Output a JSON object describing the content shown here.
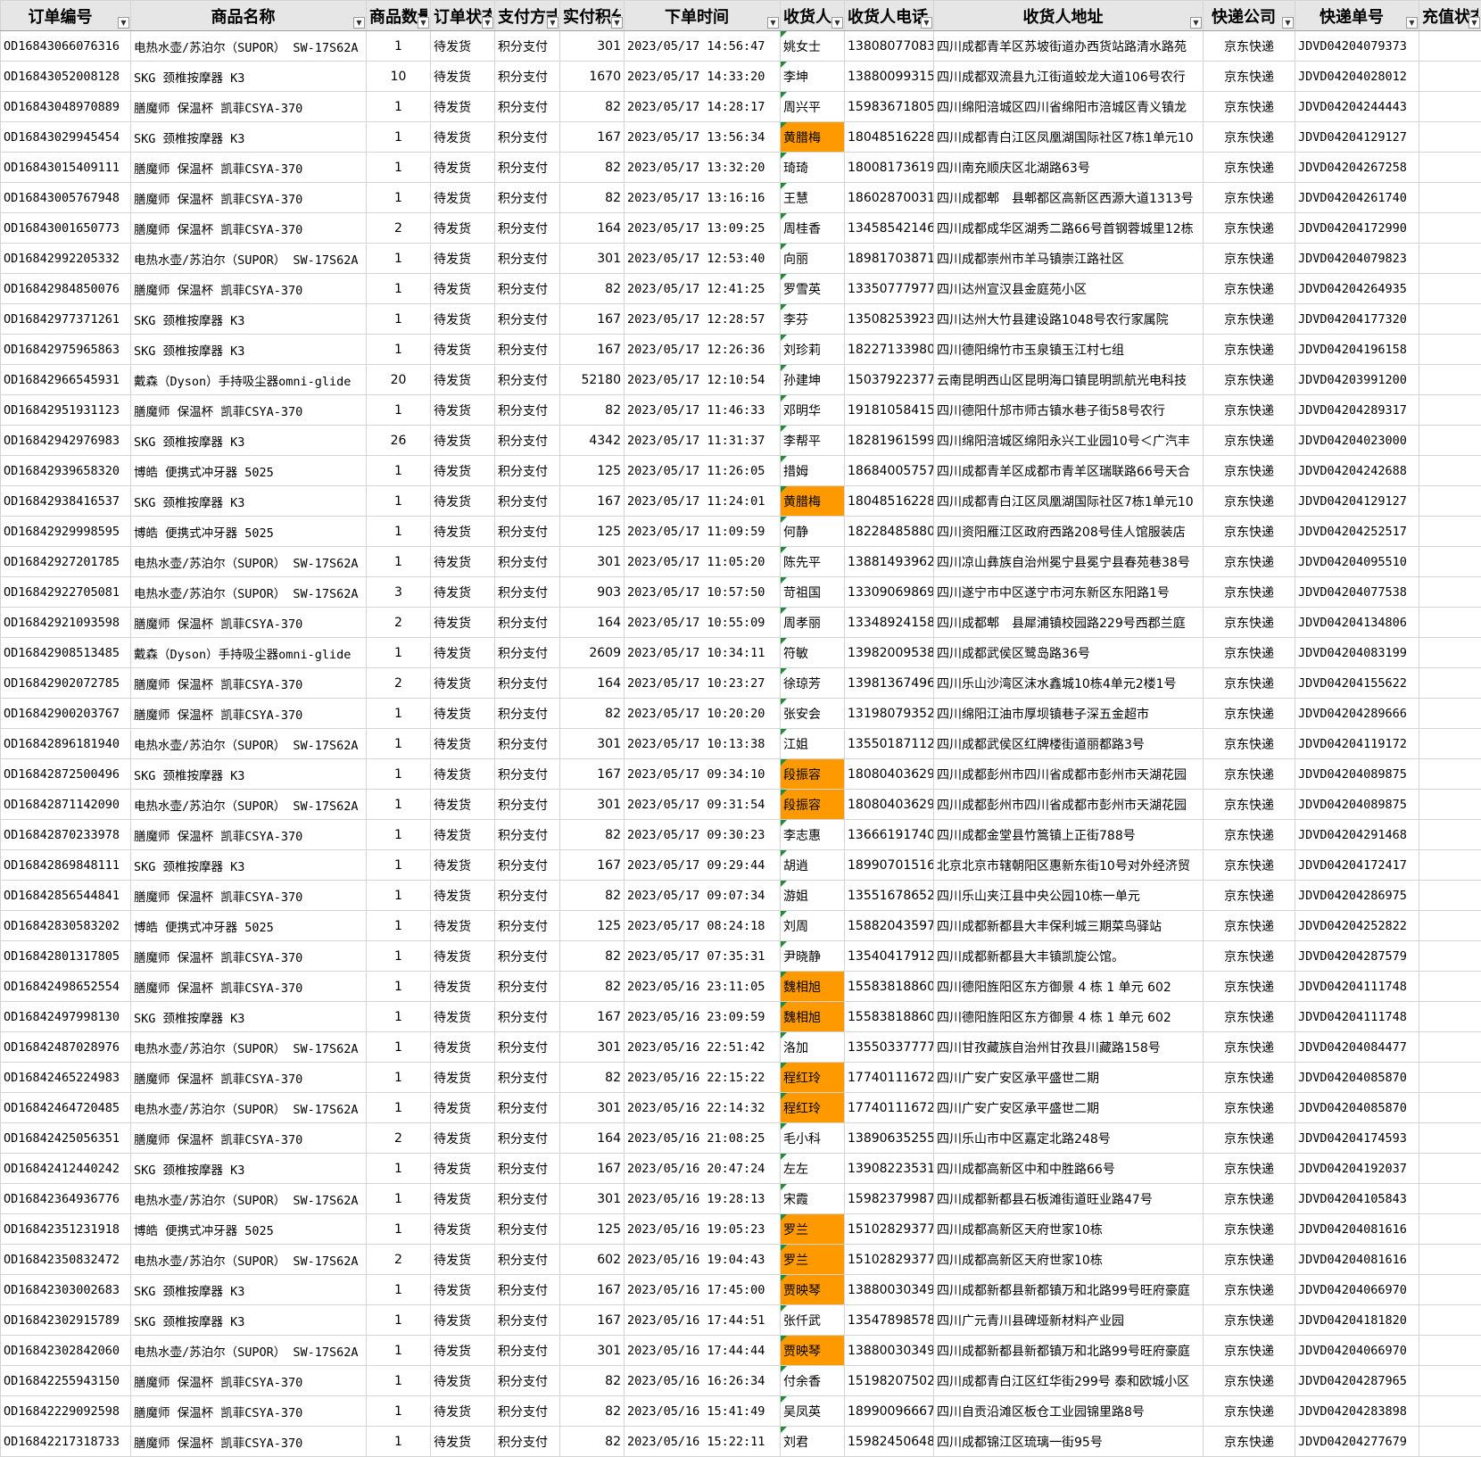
{
  "columns": [
    "订单编号",
    "商品名称",
    "商品数量",
    "订单状态",
    "支付方式",
    "实付积分",
    "下单时间",
    "收货人",
    "收货人电话",
    "收货人地址",
    "快递公司",
    "快递单号",
    "充值状态"
  ],
  "theme": {
    "highlight": "#ff9900",
    "header_bg": "#e7e6e6",
    "note_marker": "#1e8c3a"
  },
  "icons": {
    "filter": "dropdown-arrow-icon"
  },
  "rows": [
    {
      "id": "OD16843066076316",
      "product": "电热水壶/苏泊尔（SUPOR） SW-17S62A",
      "qty": "1",
      "status": "待发货",
      "pay": "积分支付",
      "points": "301",
      "time": "2023/05/17 14:56:47",
      "name": "姚女士",
      "hl": false,
      "phone": "13808077083",
      "addr": "四川成都青羊区苏坡街道办西货站路清水路苑",
      "courier": "京东快递",
      "track": "JDVD04204079373",
      "recharge": ""
    },
    {
      "id": "OD16843052008128",
      "product": "SKG 颈椎按摩器 K3",
      "qty": "10",
      "status": "待发货",
      "pay": "积分支付",
      "points": "1670",
      "time": "2023/05/17 14:33:20",
      "name": "李坤",
      "hl": false,
      "phone": "13880099315",
      "addr": "四川成都双流县九江街道蛟龙大道106号农行",
      "courier": "京东快递",
      "track": "JDVD04204028012",
      "recharge": ""
    },
    {
      "id": "OD16843048970889",
      "product": "膳魔师 保温杯 凯菲CSYA-370",
      "qty": "1",
      "status": "待发货",
      "pay": "积分支付",
      "points": "82",
      "time": "2023/05/17 14:28:17",
      "name": "周兴平",
      "hl": false,
      "phone": "15983671805",
      "addr": "四川绵阳涪城区四川省绵阳市涪城区青义镇龙",
      "courier": "京东快递",
      "track": "JDVD04204244443",
      "recharge": ""
    },
    {
      "id": "OD16843029945454",
      "product": "SKG 颈椎按摩器 K3",
      "qty": "1",
      "status": "待发货",
      "pay": "积分支付",
      "points": "167",
      "time": "2023/05/17 13:56:34",
      "name": "黄腊梅",
      "hl": true,
      "phone": "18048516228",
      "addr": "四川成都青白江区凤凰湖国际社区7栋1单元10",
      "courier": "京东快递",
      "track": "JDVD04204129127",
      "recharge": ""
    },
    {
      "id": "OD16843015409111",
      "product": "膳魔师 保温杯 凯菲CSYA-370",
      "qty": "1",
      "status": "待发货",
      "pay": "积分支付",
      "points": "82",
      "time": "2023/05/17 13:32:20",
      "name": "琦琦",
      "hl": false,
      "phone": "18008173619",
      "addr": "四川南充顺庆区北湖路63号",
      "courier": "京东快递",
      "track": "JDVD04204267258",
      "recharge": ""
    },
    {
      "id": "OD16843005767948",
      "product": "膳魔师 保温杯 凯菲CSYA-370",
      "qty": "1",
      "status": "待发货",
      "pay": "积分支付",
      "points": "82",
      "time": "2023/05/17 13:16:16",
      "name": "王慧",
      "hl": false,
      "phone": "18602870031",
      "addr": "四川成都郫　县郫都区高新区西源大道1313号",
      "courier": "京东快递",
      "track": "JDVD04204261740",
      "recharge": ""
    },
    {
      "id": "OD16843001650773",
      "product": "膳魔师 保温杯 凯菲CSYA-370",
      "qty": "2",
      "status": "待发货",
      "pay": "积分支付",
      "points": "164",
      "time": "2023/05/17 13:09:25",
      "name": "周桂香",
      "hl": false,
      "phone": "13458542146",
      "addr": "四川成都成华区湖秀二路66号首钢蓉城里12栋",
      "courier": "京东快递",
      "track": "JDVD04204172990",
      "recharge": ""
    },
    {
      "id": "OD16842992205332",
      "product": "电热水壶/苏泊尔（SUPOR） SW-17S62A",
      "qty": "1",
      "status": "待发货",
      "pay": "积分支付",
      "points": "301",
      "time": "2023/05/17 12:53:40",
      "name": "向丽",
      "hl": false,
      "phone": "18981703871",
      "addr": "四川成都崇州市羊马镇崇江路社区",
      "courier": "京东快递",
      "track": "JDVD04204079823",
      "recharge": ""
    },
    {
      "id": "OD16842984850076",
      "product": "膳魔师 保温杯 凯菲CSYA-370",
      "qty": "1",
      "status": "待发货",
      "pay": "积分支付",
      "points": "82",
      "time": "2023/05/17 12:41:25",
      "name": "罗雪英",
      "hl": false,
      "phone": "13350777977",
      "addr": "四川达州宣汉县金庭苑小区",
      "courier": "京东快递",
      "track": "JDVD04204264935",
      "recharge": ""
    },
    {
      "id": "OD16842977371261",
      "product": "SKG 颈椎按摩器 K3",
      "qty": "1",
      "status": "待发货",
      "pay": "积分支付",
      "points": "167",
      "time": "2023/05/17 12:28:57",
      "name": "李芬",
      "hl": false,
      "phone": "13508253923",
      "addr": "四川达州大竹县建设路1048号农行家属院",
      "courier": "京东快递",
      "track": "JDVD04204177320",
      "recharge": ""
    },
    {
      "id": "OD16842975965863",
      "product": "SKG 颈椎按摩器 K3",
      "qty": "1",
      "status": "待发货",
      "pay": "积分支付",
      "points": "167",
      "time": "2023/05/17 12:26:36",
      "name": "刘珍莉",
      "hl": false,
      "phone": "18227133980",
      "addr": "四川德阳绵竹市玉泉镇玉江村七组",
      "courier": "京东快递",
      "track": "JDVD04204196158",
      "recharge": ""
    },
    {
      "id": "OD16842966545931",
      "product": "戴森（Dyson）手持吸尘器omni-glide",
      "qty": "20",
      "status": "待发货",
      "pay": "积分支付",
      "points": "52180",
      "time": "2023/05/17 12:10:54",
      "name": "孙建坤",
      "hl": false,
      "phone": "15037922377",
      "addr": "云南昆明西山区昆明海口镇昆明凯航光电科技",
      "courier": "京东快递",
      "track": "JDVD04203991200",
      "recharge": ""
    },
    {
      "id": "OD16842951931123",
      "product": "膳魔师 保温杯 凯菲CSYA-370",
      "qty": "1",
      "status": "待发货",
      "pay": "积分支付",
      "points": "82",
      "time": "2023/05/17 11:46:33",
      "name": "邓明华",
      "hl": false,
      "phone": "19181058415",
      "addr": "四川德阳什邡市师古镇水巷子街58号农行",
      "courier": "京东快递",
      "track": "JDVD04204289317",
      "recharge": ""
    },
    {
      "id": "OD16842942976983",
      "product": "SKG 颈椎按摩器 K3",
      "qty": "26",
      "status": "待发货",
      "pay": "积分支付",
      "points": "4342",
      "time": "2023/05/17 11:31:37",
      "name": "李帮平",
      "hl": false,
      "phone": "18281961599",
      "addr": "四川绵阳涪城区绵阳永兴工业园10号＜广汽丰",
      "courier": "京东快递",
      "track": "JDVD04204023000",
      "recharge": ""
    },
    {
      "id": "OD16842939658320",
      "product": "博皓 便携式冲牙器 5025",
      "qty": "1",
      "status": "待发货",
      "pay": "积分支付",
      "points": "125",
      "time": "2023/05/17 11:26:05",
      "name": "措姆",
      "hl": false,
      "phone": "18684005757",
      "addr": "四川成都青羊区成都市青羊区瑞联路66号天合",
      "courier": "京东快递",
      "track": "JDVD04204242688",
      "recharge": ""
    },
    {
      "id": "OD16842938416537",
      "product": "SKG 颈椎按摩器 K3",
      "qty": "1",
      "status": "待发货",
      "pay": "积分支付",
      "points": "167",
      "time": "2023/05/17 11:24:01",
      "name": "黄腊梅",
      "hl": true,
      "phone": "18048516228",
      "addr": "四川成都青白江区凤凰湖国际社区7栋1单元10",
      "courier": "京东快递",
      "track": "JDVD04204129127",
      "recharge": ""
    },
    {
      "id": "OD16842929998595",
      "product": "博皓 便携式冲牙器 5025",
      "qty": "1",
      "status": "待发货",
      "pay": "积分支付",
      "points": "125",
      "time": "2023/05/17 11:09:59",
      "name": "何静",
      "hl": false,
      "phone": "18228485880",
      "addr": "四川资阳雁江区政府西路208号佳人馆服装店",
      "courier": "京东快递",
      "track": "JDVD04204252517",
      "recharge": ""
    },
    {
      "id": "OD16842927201785",
      "product": "电热水壶/苏泊尔（SUPOR） SW-17S62A",
      "qty": "1",
      "status": "待发货",
      "pay": "积分支付",
      "points": "301",
      "time": "2023/05/17 11:05:20",
      "name": "陈先平",
      "hl": false,
      "phone": "13881493962",
      "addr": "四川凉山彝族自治州冕宁县冕宁县春苑巷38号",
      "courier": "京东快递",
      "track": "JDVD04204095510",
      "recharge": ""
    },
    {
      "id": "OD16842922705081",
      "product": "电热水壶/苏泊尔（SUPOR） SW-17S62A",
      "qty": "3",
      "status": "待发货",
      "pay": "积分支付",
      "points": "903",
      "time": "2023/05/17 10:57:50",
      "name": "苛祖国",
      "hl": false,
      "phone": "13309069869",
      "addr": "四川遂宁市中区遂宁市河东新区东阳路1号",
      "courier": "京东快递",
      "track": "JDVD04204077538",
      "recharge": ""
    },
    {
      "id": "OD16842921093598",
      "product": "膳魔师 保温杯 凯菲CSYA-370",
      "qty": "2",
      "status": "待发货",
      "pay": "积分支付",
      "points": "164",
      "time": "2023/05/17 10:55:09",
      "name": "周孝丽",
      "hl": false,
      "phone": "13348924158",
      "addr": "四川成都郫　县犀浦镇校园路229号西郡兰庭",
      "courier": "京东快递",
      "track": "JDVD04204134806",
      "recharge": ""
    },
    {
      "id": "OD16842908513485",
      "product": "戴森（Dyson）手持吸尘器omni-glide",
      "qty": "1",
      "status": "待发货",
      "pay": "积分支付",
      "points": "2609",
      "time": "2023/05/17 10:34:11",
      "name": "符敏",
      "hl": false,
      "phone": "13982009538",
      "addr": "四川成都武侯区鹭岛路36号",
      "courier": "京东快递",
      "track": "JDVD04204083199",
      "recharge": ""
    },
    {
      "id": "OD16842902072785",
      "product": "膳魔师 保温杯 凯菲CSYA-370",
      "qty": "2",
      "status": "待发货",
      "pay": "积分支付",
      "points": "164",
      "time": "2023/05/17 10:23:27",
      "name": "徐琼芳",
      "hl": false,
      "phone": "13981367496",
      "addr": "四川乐山沙湾区沫水鑫城10栋4单元2楼1号",
      "courier": "京东快递",
      "track": "JDVD04204155622",
      "recharge": ""
    },
    {
      "id": "OD16842900203767",
      "product": "膳魔师 保温杯 凯菲CSYA-370",
      "qty": "1",
      "status": "待发货",
      "pay": "积分支付",
      "points": "82",
      "time": "2023/05/17 10:20:20",
      "name": "张安会",
      "hl": false,
      "phone": "13198079352",
      "addr": "四川绵阳江油市厚坝镇巷子深五金超市",
      "courier": "京东快递",
      "track": "JDVD04204289666",
      "recharge": ""
    },
    {
      "id": "OD16842896181940",
      "product": "电热水壶/苏泊尔（SUPOR） SW-17S62A",
      "qty": "1",
      "status": "待发货",
      "pay": "积分支付",
      "points": "301",
      "time": "2023/05/17 10:13:38",
      "name": "江姐",
      "hl": false,
      "phone": "13550187112",
      "addr": "四川成都武侯区红牌楼街道丽都路3号",
      "courier": "京东快递",
      "track": "JDVD04204119172",
      "recharge": ""
    },
    {
      "id": "OD16842872500496",
      "product": "SKG 颈椎按摩器 K3",
      "qty": "1",
      "status": "待发货",
      "pay": "积分支付",
      "points": "167",
      "time": "2023/05/17 09:34:10",
      "name": "段振容",
      "hl": true,
      "phone": "18080403629",
      "addr": "四川成都彭州市四川省成都市彭州市天湖花园",
      "courier": "京东快递",
      "track": "JDVD04204089875",
      "recharge": ""
    },
    {
      "id": "OD16842871142090",
      "product": "电热水壶/苏泊尔（SUPOR） SW-17S62A",
      "qty": "1",
      "status": "待发货",
      "pay": "积分支付",
      "points": "301",
      "time": "2023/05/17 09:31:54",
      "name": "段振容",
      "hl": true,
      "phone": "18080403629",
      "addr": "四川成都彭州市四川省成都市彭州市天湖花园",
      "courier": "京东快递",
      "track": "JDVD04204089875",
      "recharge": ""
    },
    {
      "id": "OD16842870233978",
      "product": "膳魔师 保温杯 凯菲CSYA-370",
      "qty": "1",
      "status": "待发货",
      "pay": "积分支付",
      "points": "82",
      "time": "2023/05/17 09:30:23",
      "name": "李志惠",
      "hl": false,
      "phone": "13666191740",
      "addr": "四川成都金堂县竹篙镇上正街788号",
      "courier": "京东快递",
      "track": "JDVD04204291468",
      "recharge": ""
    },
    {
      "id": "OD16842869848111",
      "product": "SKG 颈椎按摩器 K3",
      "qty": "1",
      "status": "待发货",
      "pay": "积分支付",
      "points": "167",
      "time": "2023/05/17 09:29:44",
      "name": "胡逍",
      "hl": false,
      "phone": "18990701516",
      "addr": "北京北京市辖朝阳区惠新东街10号对外经济贸",
      "courier": "京东快递",
      "track": "JDVD04204172417",
      "recharge": ""
    },
    {
      "id": "OD16842856544841",
      "product": "膳魔师 保温杯 凯菲CSYA-370",
      "qty": "1",
      "status": "待发货",
      "pay": "积分支付",
      "points": "82",
      "time": "2023/05/17 09:07:34",
      "name": "游姐",
      "hl": false,
      "phone": "13551678652",
      "addr": "四川乐山夹江县中央公园10栋一单元",
      "courier": "京东快递",
      "track": "JDVD04204286975",
      "recharge": ""
    },
    {
      "id": "OD16842830583202",
      "product": "博皓 便携式冲牙器 5025",
      "qty": "1",
      "status": "待发货",
      "pay": "积分支付",
      "points": "125",
      "time": "2023/05/17 08:24:18",
      "name": "刘周",
      "hl": false,
      "phone": "15882043597",
      "addr": "四川成都新都县大丰保利城三期菜鸟驿站",
      "courier": "京东快递",
      "track": "JDVD04204252822",
      "recharge": ""
    },
    {
      "id": "OD16842801317805",
      "product": "膳魔师 保温杯 凯菲CSYA-370",
      "qty": "1",
      "status": "待发货",
      "pay": "积分支付",
      "points": "82",
      "time": "2023/05/17 07:35:31",
      "name": "尹晓静",
      "hl": false,
      "phone": "13540417912",
      "addr": "四川成都新都县大丰镇凯旋公馆。",
      "courier": "京东快递",
      "track": "JDVD04204287579",
      "recharge": ""
    },
    {
      "id": "OD16842498652554",
      "product": "膳魔师 保温杯 凯菲CSYA-370",
      "qty": "1",
      "status": "待发货",
      "pay": "积分支付",
      "points": "82",
      "time": "2023/05/16 23:11:05",
      "name": "魏相旭",
      "hl": true,
      "phone": "15583818860",
      "addr": "四川德阳旌阳区东方御景 4 栋 1 单元 602",
      "courier": "京东快递",
      "track": "JDVD04204111748",
      "recharge": ""
    },
    {
      "id": "OD16842497998130",
      "product": "SKG 颈椎按摩器 K3",
      "qty": "1",
      "status": "待发货",
      "pay": "积分支付",
      "points": "167",
      "time": "2023/05/16 23:09:59",
      "name": "魏相旭",
      "hl": true,
      "phone": "15583818860",
      "addr": "四川德阳旌阳区东方御景 4 栋 1 单元 602",
      "courier": "京东快递",
      "track": "JDVD04204111748",
      "recharge": ""
    },
    {
      "id": "OD16842487028976",
      "product": "电热水壶/苏泊尔（SUPOR） SW-17S62A",
      "qty": "1",
      "status": "待发货",
      "pay": "积分支付",
      "points": "301",
      "time": "2023/05/16 22:51:42",
      "name": "洛加",
      "hl": false,
      "phone": "13550337777",
      "addr": "四川甘孜藏族自治州甘孜县川藏路158号",
      "courier": "京东快递",
      "track": "JDVD04204084477",
      "recharge": ""
    },
    {
      "id": "OD16842465224983",
      "product": "膳魔师 保温杯 凯菲CSYA-370",
      "qty": "1",
      "status": "待发货",
      "pay": "积分支付",
      "points": "82",
      "time": "2023/05/16 22:15:22",
      "name": "程红玲",
      "hl": true,
      "phone": "17740111672",
      "addr": "四川广安广安区承平盛世二期",
      "courier": "京东快递",
      "track": "JDVD04204085870",
      "recharge": ""
    },
    {
      "id": "OD16842464720485",
      "product": "电热水壶/苏泊尔（SUPOR） SW-17S62A",
      "qty": "1",
      "status": "待发货",
      "pay": "积分支付",
      "points": "301",
      "time": "2023/05/16 22:14:32",
      "name": "程红玲",
      "hl": true,
      "phone": "17740111672",
      "addr": "四川广安广安区承平盛世二期",
      "courier": "京东快递",
      "track": "JDVD04204085870",
      "recharge": ""
    },
    {
      "id": "OD16842425056351",
      "product": "膳魔师 保温杯 凯菲CSYA-370",
      "qty": "2",
      "status": "待发货",
      "pay": "积分支付",
      "points": "164",
      "time": "2023/05/16 21:08:25",
      "name": "毛小科",
      "hl": false,
      "phone": "13890635255",
      "addr": "四川乐山市中区嘉定北路248号",
      "courier": "京东快递",
      "track": "JDVD04204174593",
      "recharge": ""
    },
    {
      "id": "OD16842412440242",
      "product": "SKG 颈椎按摩器 K3",
      "qty": "1",
      "status": "待发货",
      "pay": "积分支付",
      "points": "167",
      "time": "2023/05/16 20:47:24",
      "name": "左左",
      "hl": false,
      "phone": "13908223531",
      "addr": "四川成都高新区中和中胜路66号",
      "courier": "京东快递",
      "track": "JDVD04204192037",
      "recharge": ""
    },
    {
      "id": "OD16842364936776",
      "product": "电热水壶/苏泊尔（SUPOR） SW-17S62A",
      "qty": "1",
      "status": "待发货",
      "pay": "积分支付",
      "points": "301",
      "time": "2023/05/16 19:28:13",
      "name": "宋霞",
      "hl": false,
      "phone": "15982379987",
      "addr": "四川成都新都县石板滩街道旺业路47号",
      "courier": "京东快递",
      "track": "JDVD04204105843",
      "recharge": ""
    },
    {
      "id": "OD16842351231918",
      "product": "博皓 便携式冲牙器 5025",
      "qty": "1",
      "status": "待发货",
      "pay": "积分支付",
      "points": "125",
      "time": "2023/05/16 19:05:23",
      "name": "罗兰",
      "hl": true,
      "phone": "15102829377",
      "addr": "四川成都高新区天府世家10栋",
      "courier": "京东快递",
      "track": "JDVD04204081616",
      "recharge": ""
    },
    {
      "id": "OD16842350832472",
      "product": "电热水壶/苏泊尔（SUPOR） SW-17S62A",
      "qty": "2",
      "status": "待发货",
      "pay": "积分支付",
      "points": "602",
      "time": "2023/05/16 19:04:43",
      "name": "罗兰",
      "hl": true,
      "phone": "15102829377",
      "addr": "四川成都高新区天府世家10栋",
      "courier": "京东快递",
      "track": "JDVD04204081616",
      "recharge": ""
    },
    {
      "id": "OD16842303002683",
      "product": "SKG 颈椎按摩器 K3",
      "qty": "1",
      "status": "待发货",
      "pay": "积分支付",
      "points": "167",
      "time": "2023/05/16 17:45:00",
      "name": "贾映琴",
      "hl": true,
      "phone": "13880030349",
      "addr": "四川成都新都县新都镇万和北路99号旺府豪庭",
      "courier": "京东快递",
      "track": "JDVD04204066970",
      "recharge": ""
    },
    {
      "id": "OD16842302915789",
      "product": "SKG 颈椎按摩器 K3",
      "qty": "1",
      "status": "待发货",
      "pay": "积分支付",
      "points": "167",
      "time": "2023/05/16 17:44:51",
      "name": "张仟武",
      "hl": false,
      "phone": "13547898578",
      "addr": "四川广元青川县碑垭新材料产业园",
      "courier": "京东快递",
      "track": "JDVD04204181820",
      "recharge": ""
    },
    {
      "id": "OD16842302842060",
      "product": "电热水壶/苏泊尔（SUPOR） SW-17S62A",
      "qty": "1",
      "status": "待发货",
      "pay": "积分支付",
      "points": "301",
      "time": "2023/05/16 17:44:44",
      "name": "贾映琴",
      "hl": true,
      "phone": "13880030349",
      "addr": "四川成都新都县新都镇万和北路99号旺府豪庭",
      "courier": "京东快递",
      "track": "JDVD04204066970",
      "recharge": ""
    },
    {
      "id": "OD16842255943150",
      "product": "膳魔师 保温杯 凯菲CSYA-370",
      "qty": "1",
      "status": "待发货",
      "pay": "积分支付",
      "points": "82",
      "time": "2023/05/16 16:26:34",
      "name": "付余香",
      "hl": false,
      "phone": "15198207502",
      "addr": "四川成都青白江区红华街299号 泰和欧城小区",
      "courier": "京东快递",
      "track": "JDVD04204287965",
      "recharge": ""
    },
    {
      "id": "OD16842229092598",
      "product": "膳魔师 保温杯 凯菲CSYA-370",
      "qty": "1",
      "status": "待发货",
      "pay": "积分支付",
      "points": "82",
      "time": "2023/05/16 15:41:49",
      "name": "吴凤英",
      "hl": false,
      "phone": "18990096667",
      "addr": "四川自贡沿滩区板仓工业园锦里路8号",
      "courier": "京东快递",
      "track": "JDVD04204283898",
      "recharge": ""
    },
    {
      "id": "OD16842217318733",
      "product": "膳魔师 保温杯 凯菲CSYA-370",
      "qty": "1",
      "status": "待发货",
      "pay": "积分支付",
      "points": "82",
      "time": "2023/05/16 15:22:11",
      "name": "刘君",
      "hl": false,
      "phone": "15982450648",
      "addr": "四川成都锦江区琉璃一街95号",
      "courier": "京东快递",
      "track": "JDVD04204277679",
      "recharge": ""
    }
  ]
}
